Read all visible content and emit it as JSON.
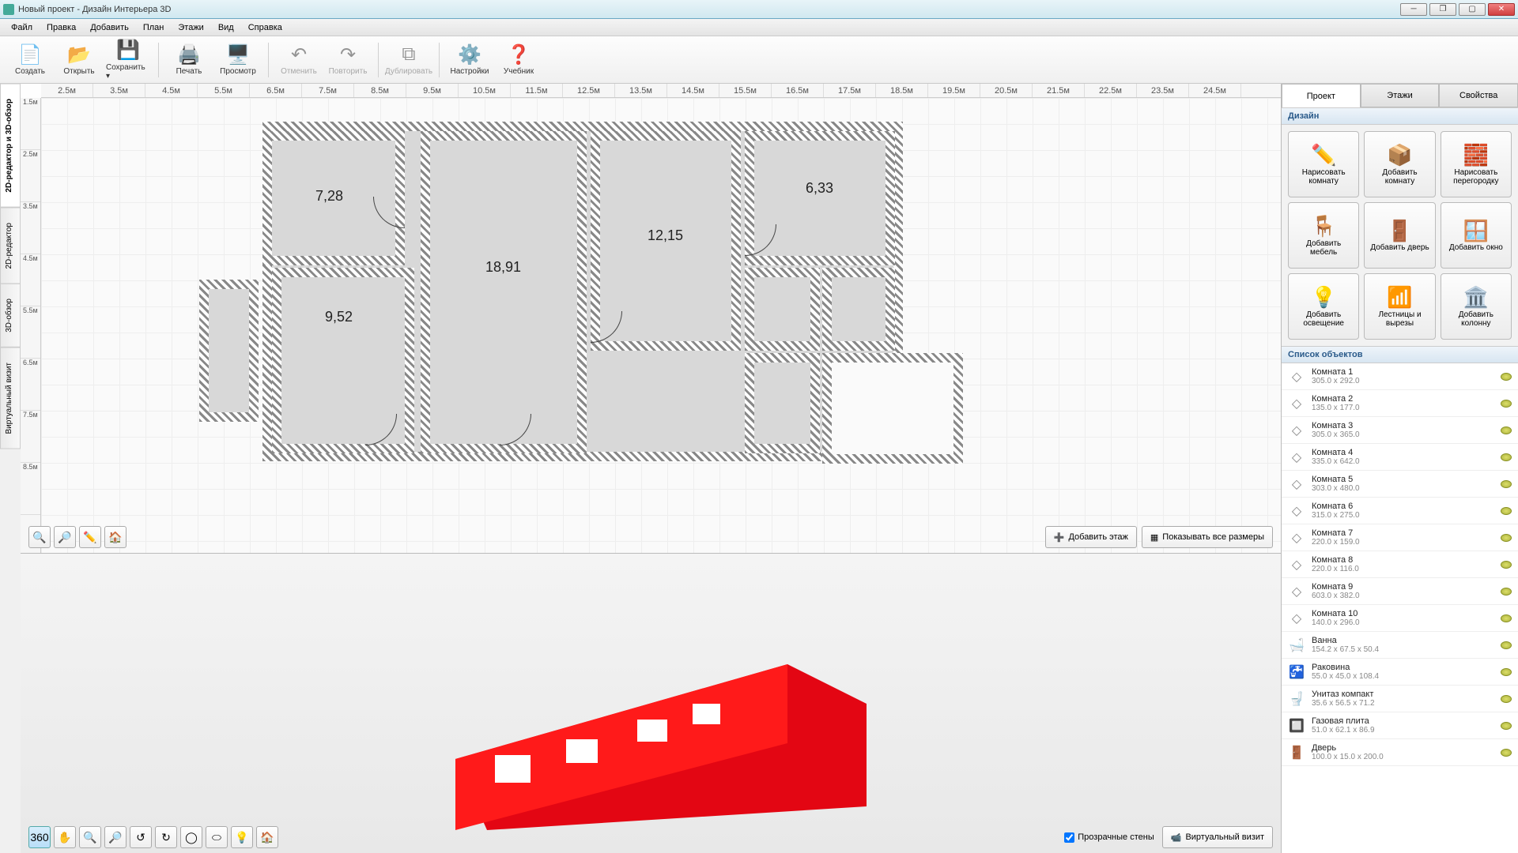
{
  "window": {
    "title": "Новый проект - Дизайн Интерьера 3D"
  },
  "menu": [
    "Файл",
    "Правка",
    "Добавить",
    "План",
    "Этажи",
    "Вид",
    "Справка"
  ],
  "toolbar": [
    {
      "label": "Создать",
      "icon": "📄"
    },
    {
      "label": "Открыть",
      "icon": "📂"
    },
    {
      "label": "Сохранить",
      "icon": "💾",
      "split": true
    },
    {
      "sep": true
    },
    {
      "label": "Печать",
      "icon": "🖨️"
    },
    {
      "label": "Просмотр",
      "icon": "🖥️"
    },
    {
      "sep": true
    },
    {
      "label": "Отменить",
      "icon": "↶",
      "disabled": true
    },
    {
      "label": "Повторить",
      "icon": "↷",
      "disabled": true
    },
    {
      "sep": true
    },
    {
      "label": "Дублировать",
      "icon": "⧉",
      "disabled": true
    },
    {
      "sep": true
    },
    {
      "label": "Настройки",
      "icon": "⚙️"
    },
    {
      "label": "Учебник",
      "icon": "❓"
    }
  ],
  "sidetabs": [
    "2D-редактор и 3D-обзор",
    "2D-редактор",
    "3D-обзор",
    "Виртуальный визит"
  ],
  "ruler_h": [
    "2.5м",
    "3.5м",
    "4.5м",
    "5.5м",
    "6.5м",
    "7.5м",
    "8.5м",
    "9.5м",
    "10.5м",
    "11.5м",
    "12.5м",
    "13.5м",
    "14.5м",
    "15.5м",
    "16.5м",
    "17.5м",
    "18.5м",
    "19.5м",
    "20.5м",
    "21.5м",
    "22.5м",
    "23.5м",
    "24.5м"
  ],
  "ruler_v": [
    "1.5м",
    "2.5м",
    "3.5м",
    "4.5м",
    "5.5м",
    "6.5м",
    "7.5м",
    "8.5м"
  ],
  "rooms": {
    "r1": "7,28",
    "r2": "18,91",
    "r3": "12,15",
    "r4": "6,33",
    "r5": "9,52"
  },
  "plan_btns": {
    "add_floor": "Добавить этаж",
    "show_dims": "Показывать все размеры"
  },
  "preview": {
    "transparent": "Прозрачные стены",
    "virtual": "Виртуальный визит"
  },
  "rtabs": [
    "Проект",
    "Этажи",
    "Свойства"
  ],
  "sections": {
    "design": "Дизайн",
    "objects": "Список объектов"
  },
  "design": [
    {
      "label": "Нарисовать комнату",
      "icon": "✏️"
    },
    {
      "label": "Добавить комнату",
      "icon": "📦"
    },
    {
      "label": "Нарисовать перегородку",
      "icon": "🧱"
    },
    {
      "label": "Добавить мебель",
      "icon": "🪑"
    },
    {
      "label": "Добавить дверь",
      "icon": "🚪"
    },
    {
      "label": "Добавить окно",
      "icon": "🪟"
    },
    {
      "label": "Добавить освещение",
      "icon": "💡"
    },
    {
      "label": "Лестницы и вырезы",
      "icon": "📶"
    },
    {
      "label": "Добавить колонну",
      "icon": "🏛️"
    }
  ],
  "objects": [
    {
      "name": "Комната 1",
      "dim": "305.0 x 292.0",
      "icon": "◇"
    },
    {
      "name": "Комната 2",
      "dim": "135.0 x 177.0",
      "icon": "◇"
    },
    {
      "name": "Комната 3",
      "dim": "305.0 x 365.0",
      "icon": "◇"
    },
    {
      "name": "Комната 4",
      "dim": "335.0 x 642.0",
      "icon": "◇"
    },
    {
      "name": "Комната 5",
      "dim": "303.0 x 480.0",
      "icon": "◇"
    },
    {
      "name": "Комната 6",
      "dim": "315.0 x 275.0",
      "icon": "◇"
    },
    {
      "name": "Комната 7",
      "dim": "220.0 x 159.0",
      "icon": "◇"
    },
    {
      "name": "Комната 8",
      "dim": "220.0 x 116.0",
      "icon": "◇"
    },
    {
      "name": "Комната 9",
      "dim": "603.0 x 382.0",
      "icon": "◇"
    },
    {
      "name": "Комната 10",
      "dim": "140.0 x 296.0",
      "icon": "◇"
    },
    {
      "name": "Ванна",
      "dim": "154.2 x 67.5 x 50.4",
      "icon": "🛁"
    },
    {
      "name": "Раковина",
      "dim": "55.0 x 45.0 x 108.4",
      "icon": "🚰"
    },
    {
      "name": "Унитаз компакт",
      "dim": "35.6 x 56.5 x 71.2",
      "icon": "🚽"
    },
    {
      "name": "Газовая плита",
      "dim": "51.0 x 62.1 x 86.9",
      "icon": "🔲"
    },
    {
      "name": "Дверь",
      "dim": "100.0 x 15.0 x 200.0",
      "icon": "🚪"
    }
  ]
}
